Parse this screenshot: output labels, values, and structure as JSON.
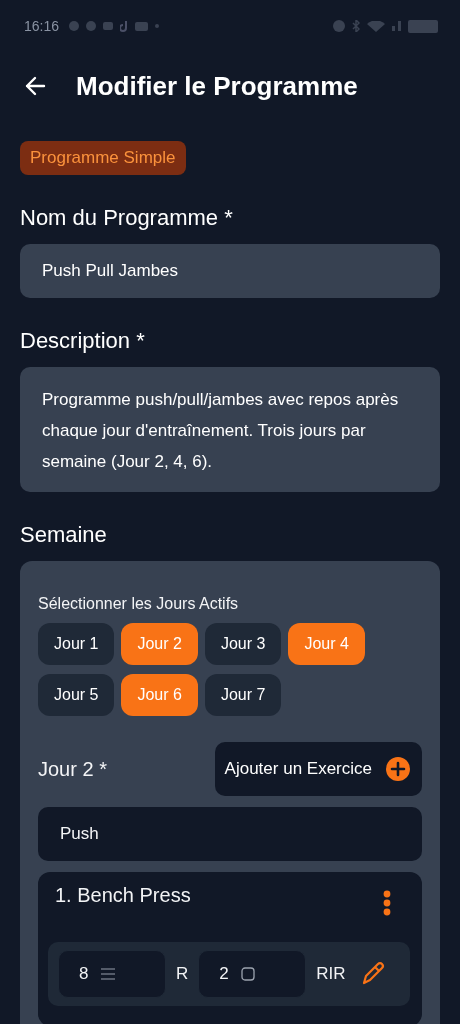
{
  "status_bar": {
    "time": "16:16"
  },
  "header": {
    "title": "Modifier le Programme"
  },
  "badge": "Programme Simple",
  "name_field": {
    "label": "Nom du Programme *",
    "value": "Push Pull Jambes"
  },
  "description_field": {
    "label": "Description *",
    "value": "Programme push/pull/jambes avec repos après chaque jour d'entraînement. Trois jours par semaine (Jour 2, 4, 6)."
  },
  "week": {
    "title": "Semaine",
    "days_label": "Sélectionner les Jours Actifs",
    "days": [
      {
        "label": "Jour 1",
        "selected": false
      },
      {
        "label": "Jour 2",
        "selected": true
      },
      {
        "label": "Jour 3",
        "selected": false
      },
      {
        "label": "Jour 4",
        "selected": true
      },
      {
        "label": "Jour 5",
        "selected": false
      },
      {
        "label": "Jour 6",
        "selected": true
      },
      {
        "label": "Jour 7",
        "selected": false
      }
    ],
    "day_detail": {
      "title": "Jour 2 *",
      "add_button": "Ajouter un Exercice",
      "name_value": "Push",
      "exercises": [
        {
          "title": "1. Bench Press",
          "sets": [
            {
              "reps": "8",
              "reps_unit": "R",
              "rir": "2",
              "rir_unit": "RIR"
            }
          ]
        }
      ]
    }
  }
}
